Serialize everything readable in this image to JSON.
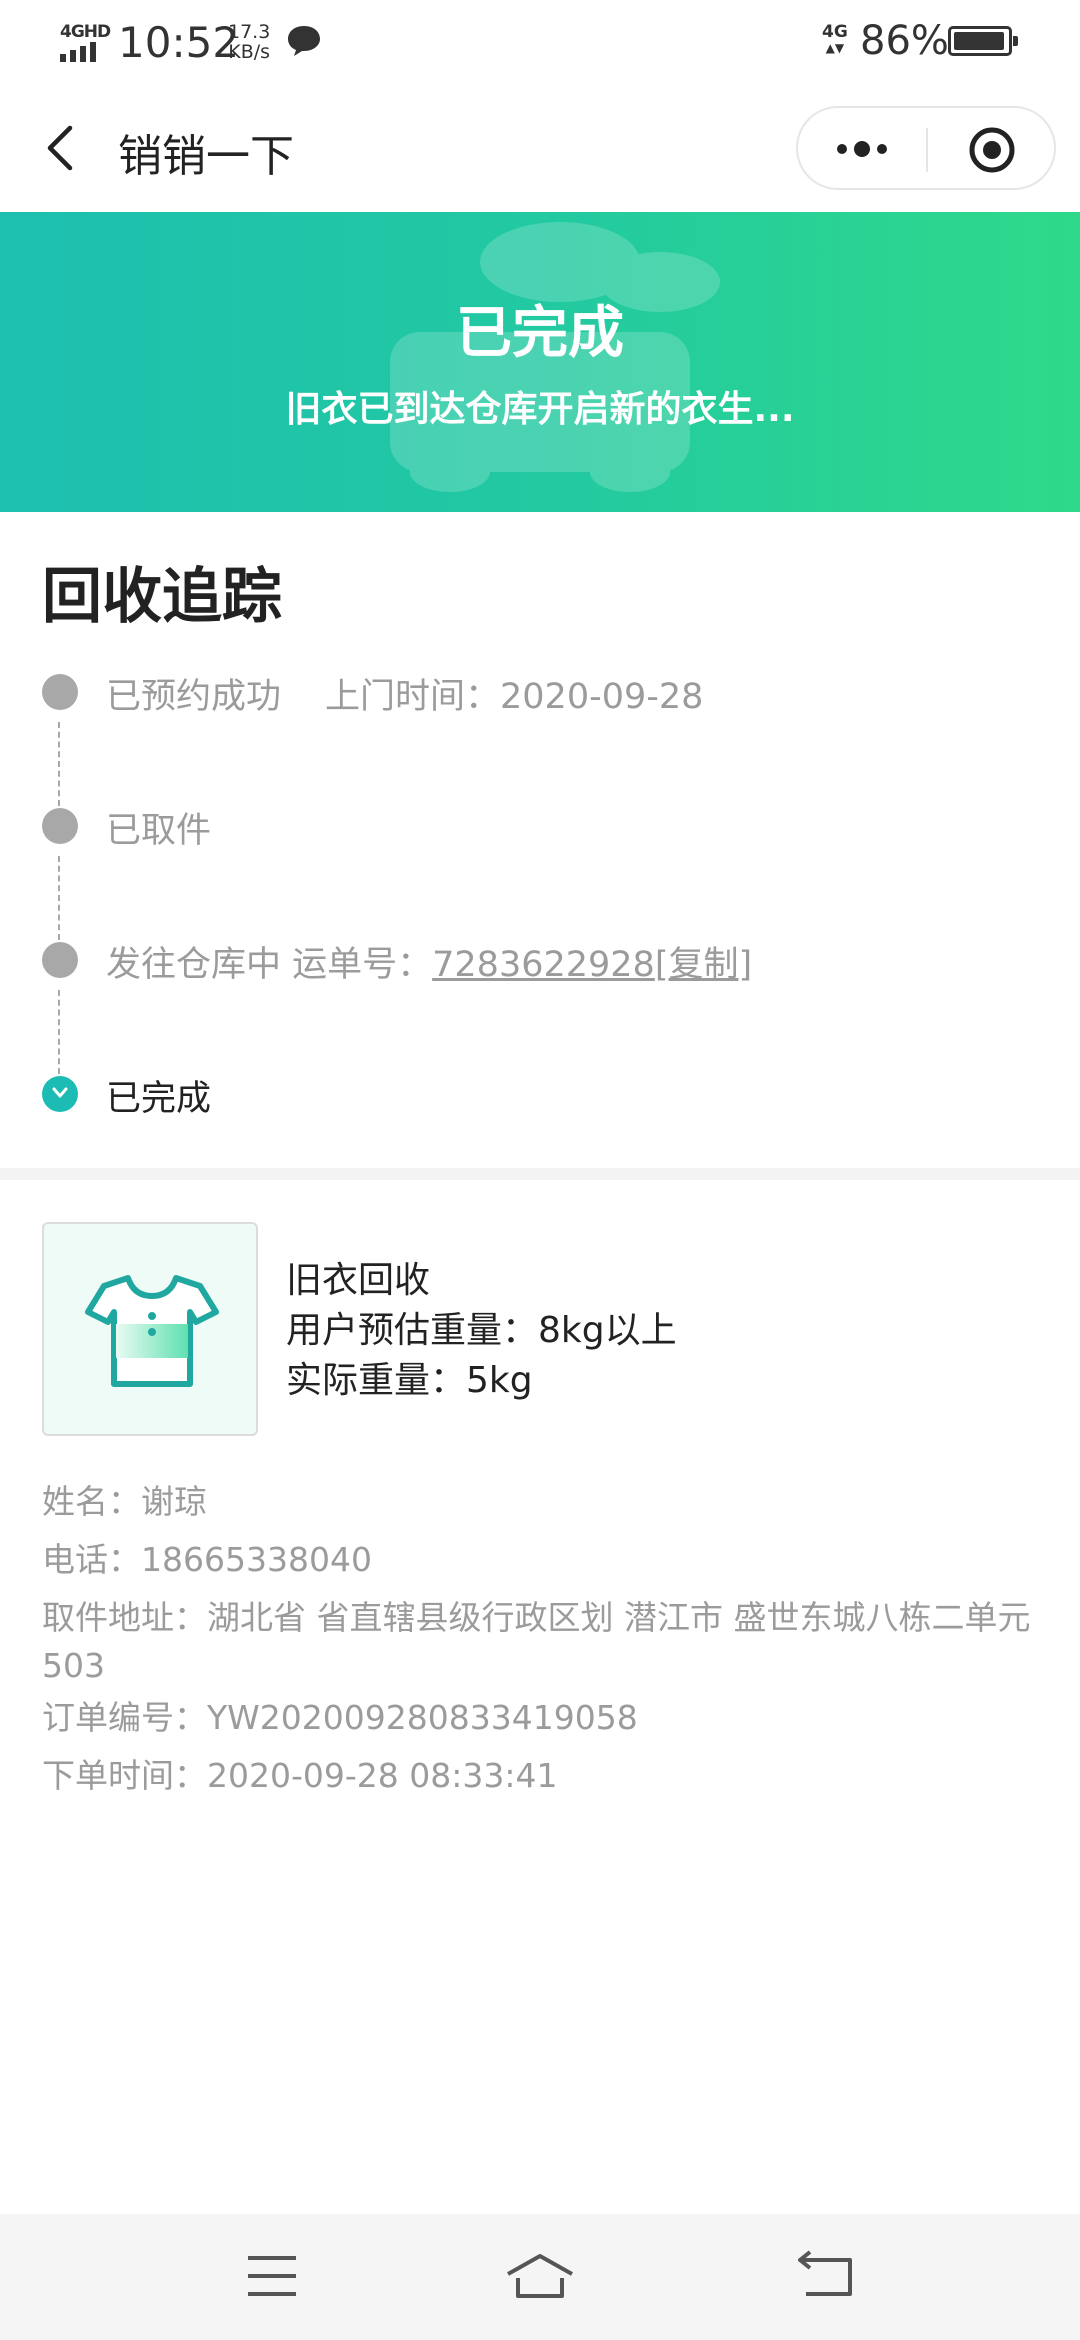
{
  "status_bar": {
    "network": "4GHD",
    "time": "10:52",
    "speed_value": "17.3",
    "speed_unit": "KB/s",
    "network_right": "4G",
    "battery_percent": "86%"
  },
  "nav": {
    "title": "销销一下"
  },
  "banner": {
    "title": "已完成",
    "subtitle": "旧衣已到达仓库开启新的衣生..."
  },
  "tracking": {
    "heading": "回收追踪",
    "steps": [
      {
        "label": "已预约成功",
        "detail": "上门时间：2020-09-28"
      },
      {
        "label": "已取件"
      },
      {
        "label": "发往仓库中 运单号：",
        "tracking_no": "7283622928",
        "copy": "[复制]"
      },
      {
        "label": "已完成"
      }
    ]
  },
  "product": {
    "name": "旧衣回收",
    "estimated_weight": "用户预估重量：8kg以上",
    "actual_weight": "实际重量：5kg"
  },
  "order_info": {
    "name": "姓名：谢琼",
    "phone": "电话：18665338040",
    "address_line1": "取件地址：湖北省 省直辖县级行政区划 潜江市 盛世东城八栋二单元",
    "address_line2": "503",
    "order_no": "订单编号：YW202009280833419058",
    "order_time": "下单时间：2020-09-28 08:33:41"
  },
  "colors": {
    "banner_start": "#1dbfaf",
    "banner_end": "#2fd98a",
    "done_dot": "#1cbcb4",
    "pending_dot": "#a8a8a8"
  }
}
